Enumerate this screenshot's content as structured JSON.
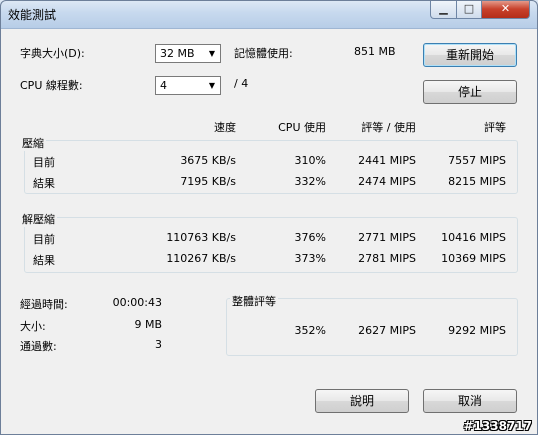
{
  "window": {
    "title": "效能測試"
  },
  "dictionary": {
    "label": "字典大小(D):",
    "value": "32 MB"
  },
  "memory": {
    "label": "記憶體使用:",
    "value": "851 MB"
  },
  "cpu_threads": {
    "label": "CPU 線程數:",
    "value": "4",
    "suffix": "/ 4"
  },
  "buttons": {
    "restart": "重新開始",
    "stop": "停止",
    "help": "說明",
    "cancel": "取消"
  },
  "headers": {
    "speed": "速度",
    "cpu": "CPU 使用",
    "rating_usage": "評等 / 使用",
    "rating": "評等"
  },
  "compress": {
    "title": "壓縮",
    "rows": [
      {
        "label": "目前",
        "speed": "3675 KB/s",
        "cpu": "310%",
        "rating_usage": "2441 MIPS",
        "rating": "7557 MIPS"
      },
      {
        "label": "結果",
        "speed": "7195 KB/s",
        "cpu": "332%",
        "rating_usage": "2474 MIPS",
        "rating": "8215 MIPS"
      }
    ]
  },
  "decompress": {
    "title": "解壓縮",
    "rows": [
      {
        "label": "目前",
        "speed": "110763 KB/s",
        "cpu": "376%",
        "rating_usage": "2771 MIPS",
        "rating": "10416 MIPS"
      },
      {
        "label": "結果",
        "speed": "110267 KB/s",
        "cpu": "373%",
        "rating_usage": "2781 MIPS",
        "rating": "10369 MIPS"
      }
    ]
  },
  "stats": {
    "elapsed_label": "經過時間:",
    "elapsed": "00:00:43",
    "size_label": "大小:",
    "size": "9 MB",
    "passes_label": "通過數:",
    "passes": "3"
  },
  "overall": {
    "title": "整體評等",
    "cpu": "352%",
    "rating_usage": "2627 MIPS",
    "rating": "9292 MIPS"
  },
  "watermark": "#1338717"
}
